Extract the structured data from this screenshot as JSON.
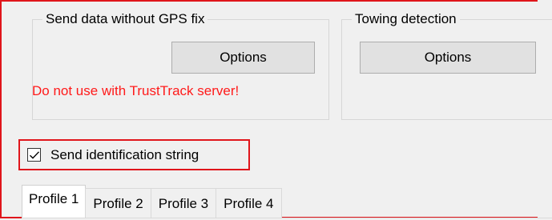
{
  "gps_group": {
    "title": "Send data without GPS fix",
    "options_label": "Options",
    "warning": "Do not use with TrustTrack server!"
  },
  "towing_group": {
    "title": "Towing detection",
    "options_label": "Options"
  },
  "send_identification": {
    "label": "Send identification string",
    "checked": true
  },
  "tabs": [
    {
      "label": "Profile 1",
      "active": true
    },
    {
      "label": "Profile 2",
      "active": false
    },
    {
      "label": "Profile 3",
      "active": false
    },
    {
      "label": "Profile 4",
      "active": false
    }
  ],
  "colors": {
    "highlight": "#e0151b",
    "warning": "#ff1a1a",
    "background": "#f0f0f0"
  }
}
